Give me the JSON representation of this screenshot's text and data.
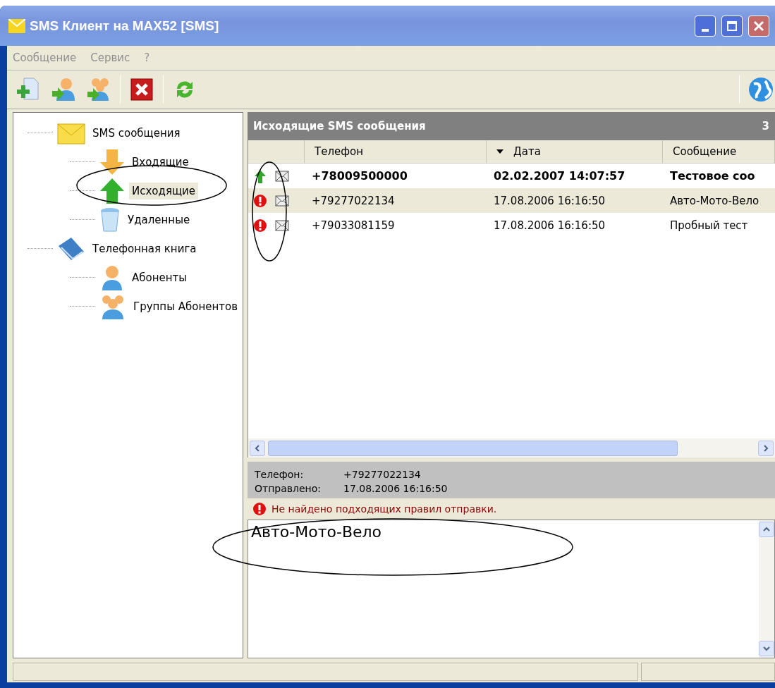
{
  "window": {
    "title": "SMS Клиент на MAX52 [SMS]"
  },
  "menu": [
    {
      "label": "Сообщение"
    },
    {
      "label": "Сервис"
    },
    {
      "label": "?"
    }
  ],
  "toolbar": [
    {
      "kind": "new"
    },
    {
      "kind": "send-contact"
    },
    {
      "kind": "send-group"
    },
    {
      "kind": "separator"
    },
    {
      "kind": "delete"
    },
    {
      "kind": "separator"
    },
    {
      "kind": "refresh"
    }
  ],
  "tree": [
    {
      "label": "SMS сообщения",
      "kind": "mail",
      "selected": false,
      "children": [
        {
          "label": "Входящие",
          "kind": "inbox",
          "selected": false
        },
        {
          "label": "Исходящие",
          "kind": "outbox",
          "selected": true
        },
        {
          "label": "Удаленные",
          "kind": "trash",
          "selected": false
        }
      ]
    },
    {
      "label": "Телефонная книга",
      "kind": "book",
      "selected": false,
      "children": [
        {
          "label": "Абоненты",
          "kind": "contact",
          "selected": false
        },
        {
          "label": "Группы Абонентов",
          "kind": "group",
          "selected": false
        }
      ]
    }
  ],
  "list": {
    "title": "Исходящие SMS сообщения",
    "count": "3",
    "columns": [
      {
        "label": "Телефон",
        "sorted": false
      },
      {
        "label": "Дата",
        "sorted": true
      },
      {
        "label": "Сообщение",
        "sorted": false
      }
    ],
    "rows": [
      {
        "kind": "sent",
        "phone": "+78009500000",
        "date": "02.02.2007 14:07:57",
        "message": "Тестовое соо",
        "unread": true,
        "selected": false
      },
      {
        "kind": "error",
        "phone": "+79277022134",
        "date": "17.08.2006 16:16:50",
        "message": "Авто-Мото-Вело",
        "unread": false,
        "selected": true
      },
      {
        "kind": "error",
        "phone": "+79033081159",
        "date": "17.08.2006 16:16:50",
        "message": "Пробный тест",
        "unread": false,
        "selected": false
      }
    ]
  },
  "details": {
    "fields": [
      {
        "label": "Телефон:",
        "value": "+79277022134"
      },
      {
        "label": "Отправлено:",
        "value": "17.08.2006 16:16:50"
      }
    ],
    "error": "Не найдено подходящих правил отправки.",
    "body": "Авто-Мото-Вело"
  }
}
